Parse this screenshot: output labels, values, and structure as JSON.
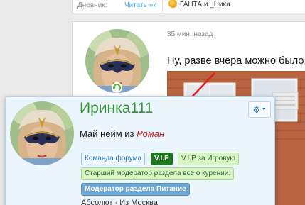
{
  "top_post": {
    "diary_label": "Дневник:",
    "read_link": "Читать »»",
    "snippet": "ГАНТА и _Ника"
  },
  "post": {
    "time": "35 мин. назад",
    "text": "Ну, разве вчера можно было"
  },
  "card": {
    "username": "Иринка111",
    "status_prefix": "Май нейм из",
    "status_highlight": "Роман",
    "badges": {
      "team": "Команда форума",
      "vip": "V.I.P",
      "vip_game": "V.I.P за Игровую",
      "senior_mod": "Старший модератор раздела все о курении.",
      "food_mod": "Модератор раздела Питание"
    },
    "meta": "Абсолют · Из Москва"
  },
  "colors": {
    "username_green": "#349433",
    "link_blue": "#47a7eb",
    "arrow_red": "#e5191c",
    "card_bg": "#eaf5fd"
  },
  "icons": {
    "gear": "gear-icon",
    "caret": "chevron-down-icon",
    "online": "online-status-icon",
    "mood": "mood-emoji-icon"
  }
}
